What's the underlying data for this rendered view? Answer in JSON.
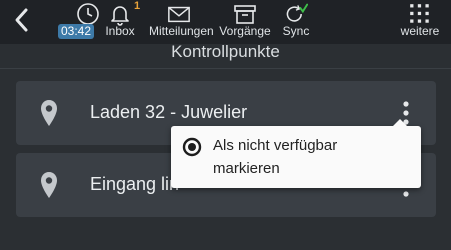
{
  "toolbar": {
    "back_icon": "chevron-left-icon",
    "time": "03:42",
    "inbox_label": "Inbox",
    "inbox_badge": "1",
    "messages_label": "Mitteilungen",
    "processes_label": "Vorgänge",
    "sync_label": "Sync",
    "more_label": "weitere"
  },
  "page": {
    "title": "Kontrollpunkte"
  },
  "checkpoints": [
    {
      "label": "Laden 32 - Juwelier"
    },
    {
      "label": "Eingang lin"
    }
  ],
  "context_menu": {
    "option_line1": "Als nicht verfügbar",
    "option_line2": "markieren"
  },
  "colors": {
    "background": "#2b2f33",
    "toolbar": "#1f2226",
    "card": "#3a3f45",
    "accent_badge": "#3d7aa8",
    "badge_orange": "#e8a23a",
    "sync_check": "#3fbf4a"
  }
}
